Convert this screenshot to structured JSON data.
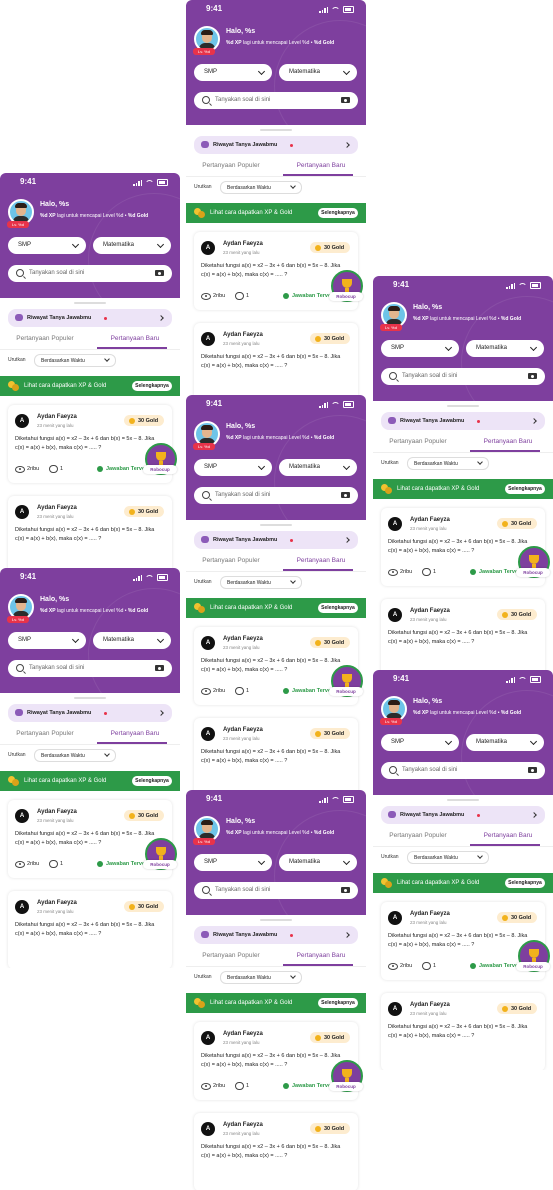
{
  "screen": {
    "time": "9:41",
    "greeting": "Halo, %s",
    "xp_prefix": "%d XP",
    "xp_middle": " lagi untuk mencapai Level %d • ",
    "xp_gold": "%d Gold",
    "level_badge": "Lv. %d",
    "filters": {
      "level": "SMP",
      "subject": "Matematika"
    },
    "search_placeholder": "Tanyakan soal di sini",
    "history_label": "Riwayat Tanya Jawabmu",
    "tabs": [
      "Pertanyaan Populer",
      "Pertanyaan Baru"
    ],
    "active_tab": 1,
    "sort_label": "Urutkan",
    "sort_value": "Berdasarkan Waktu",
    "banner_text": "Lihat cara dapatkan XP & Gold",
    "banner_button": "Selengkapnya",
    "robocup_label": "Robocup",
    "questions": [
      {
        "avatar_letter": "A",
        "name": "Aydan Faeyza",
        "time": "23 menit yang lalu",
        "reward": "30 Gold",
        "text": "Diketahui fungsi a(x) = x2 – 3x + 6 dan b(x) = 5x – 8. Jika c(x) = a(x) + b(x), maka c(x) = ..... ?",
        "views": "2ribu",
        "answers": "1",
        "status": "Jawaban Terverifikasi"
      },
      {
        "avatar_letter": "A",
        "name": "Aydan Faeyza",
        "time": "23 menit yang lalu",
        "reward": "30 Gold",
        "text": "Diketahui fungsi a(x) = x2 – 3x + 6 dan b(x) = 5x – 8. Jika c(x) = a(x) + b(x), maka c(x) = ..... ?"
      }
    ]
  },
  "colors": {
    "brand_purple": "#7e3f9e",
    "banner_green": "#2d9a48",
    "gold_bg": "#fdeccf",
    "alert_red": "#e8334a"
  }
}
